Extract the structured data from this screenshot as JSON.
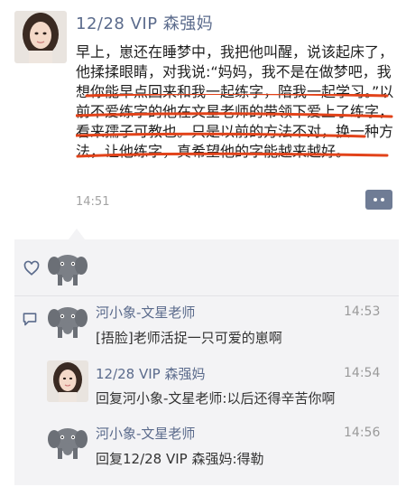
{
  "post": {
    "author": "12/28 VIP 森强妈",
    "text": "早上，崽还在睡梦中，我把他叫醒，说该起床了，他揉揉眼睛，对我说:“妈妈，我不是在做梦吧，我想你能早点回来和我一起练字，陪我一起学习。”以前不爱练字的他在文星老师的带领下爱上了练字，看来孺子可教也。只是以前的方法不对，换一种方法，让他练字，真希望他的字能越来越好。",
    "time": "14:51"
  },
  "comments": [
    {
      "name": "河小象-文星老师",
      "time": "14:53",
      "text": "[捂脸]老师活捉一只可爱的崽啊"
    },
    {
      "name": "12/28 VIP 森强妈",
      "time": "14:54",
      "text": "回复河小象-文星老师:以后还得辛苦你啊"
    },
    {
      "name": "河小象-文星老师",
      "time": "14:56",
      "text": "回复12/28 VIP 森强妈:得勒"
    }
  ],
  "icons": {
    "like": "heart-outline-icon",
    "comment": "comment-bubble-icon",
    "more": "more-dots-icon"
  },
  "colors": {
    "name": "#5b6b8c",
    "underline": "#e2431a",
    "comment_bg": "#f3f3f5"
  }
}
